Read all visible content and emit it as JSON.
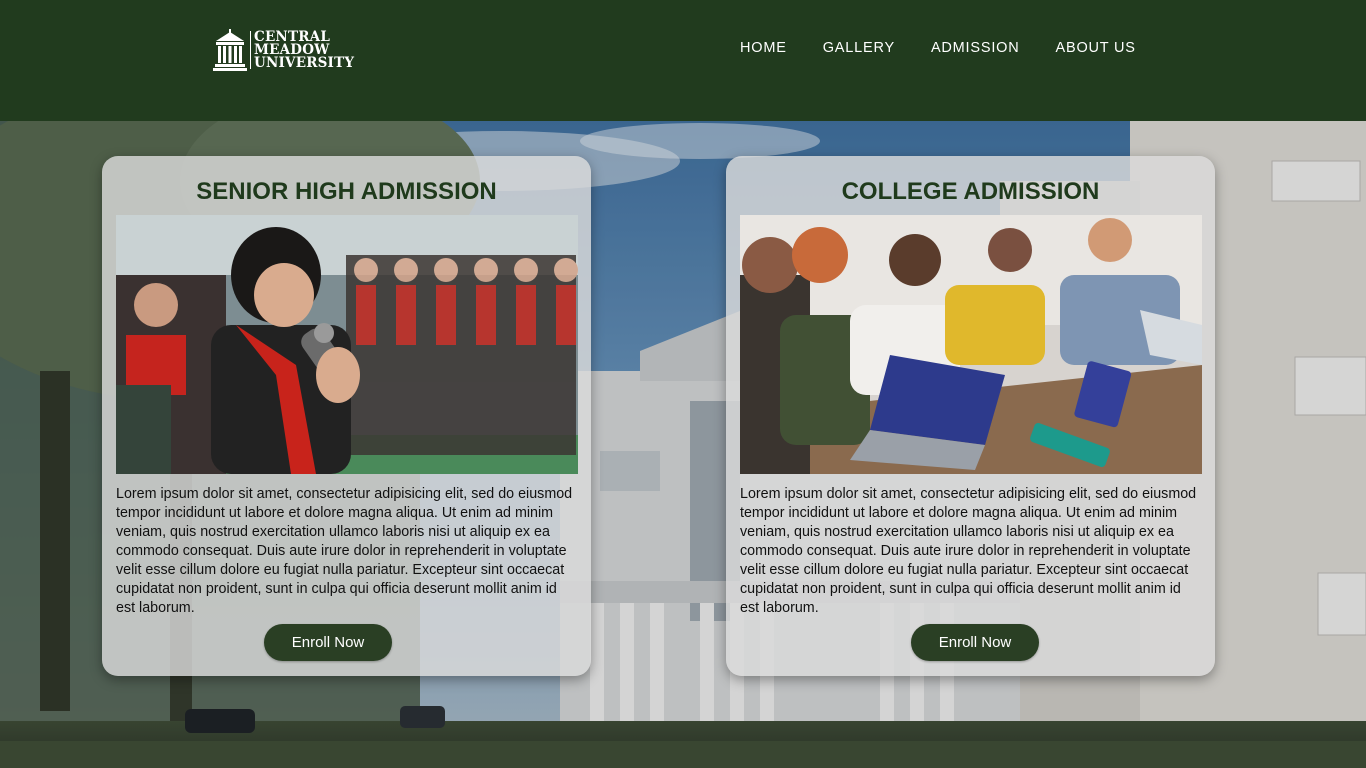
{
  "brand": {
    "line1": "CENTRAL",
    "line2": "MEADOW",
    "line3": "UNIVERSITY",
    "logo_icon": "university-building-icon"
  },
  "nav": {
    "items": [
      "HOME",
      "GALLERY",
      "ADMISSION",
      "ABOUT US"
    ]
  },
  "cards": [
    {
      "title": "SENIOR HIGH ADMISSION",
      "body": "Lorem ipsum dolor sit amet, consectetur adipisicing elit, sed do eiusmod tempor incididunt ut labore et dolore magna aliqua. Ut enim ad minim veniam, quis nostrud exercitation ullamco laboris nisi ut aliquip ex ea commodo consequat. Duis aute irure dolor in reprehenderit in voluptate velit esse cillum dolore eu fugiat nulla pariatur. Excepteur sint occaecat cupidatat non proident, sunt in culpa qui officia deserunt mollit anim id est laborum.",
      "button": "Enroll Now"
    },
    {
      "title": "COLLEGE ADMISSION",
      "body": "Lorem ipsum dolor sit amet, consectetur adipisicing elit, sed do eiusmod tempor incididunt ut labore et dolore magna aliqua. Ut enim ad minim veniam, quis nostrud exercitation ullamco laboris nisi ut aliquip ex ea commodo consequat. Duis aute irure dolor in reprehenderit in voluptate velit esse cillum dolore eu fugiat nulla pariatur. Excepteur sint occaecat cupidatat non proident, sunt in culpa qui officia deserunt mollit anim id est laborum.",
      "button": "Enroll Now"
    }
  ],
  "colors": {
    "header_bg": "#213b1e",
    "title_green": "#1f3a1c",
    "button_bg": "#2a3f24"
  }
}
